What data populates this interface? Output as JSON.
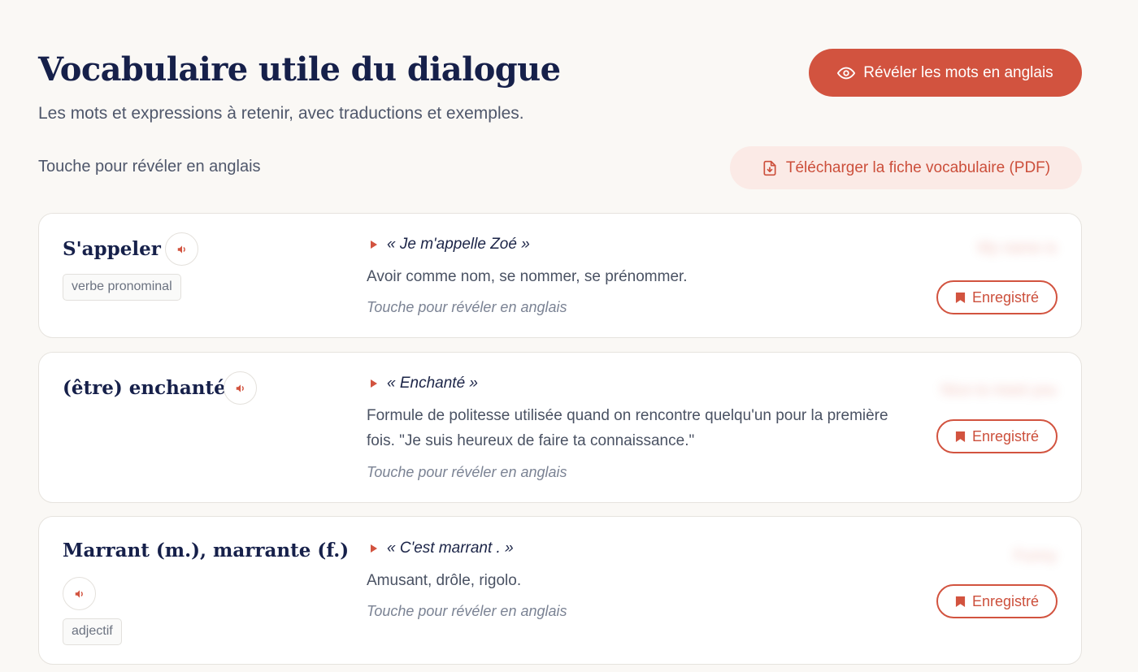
{
  "header": {
    "title": "Vocabulaire utile du dialogue",
    "subtitle": "Les mots et expressions à retenir, avec traductions et exemples.",
    "reveal_all_label": "Révéler les mots en anglais",
    "hint": "Touche pour révéler en anglais",
    "download_label": "Télécharger la fiche vocabulaire (PDF)"
  },
  "colors": {
    "accent": "#d2533f",
    "title": "#16204a",
    "background": "#faf8f5"
  },
  "icons": {
    "reveal": "eye-icon",
    "download": "file-download-icon",
    "audio": "speaker-icon",
    "example": "play-triangle-icon",
    "saved": "bookmark-icon"
  },
  "cards": [
    {
      "term": "S'appeler",
      "tag": "verbe pronominal",
      "example": "« Je m'appelle Zoé »",
      "definition": "Avoir comme nom, se nommer, se prénommer.",
      "hint": "Touche pour révéler en anglais",
      "translation": "My name is",
      "saved_label": "Enregistré"
    },
    {
      "term": "(être) enchanté",
      "tag": "",
      "example": "« Enchanté »",
      "definition": "Formule de politesse utilisée quand on rencontre quelqu'un pour la première fois. \"Je suis heureux de faire ta connaissance.\"",
      "hint": "Touche pour révéler en anglais",
      "translation": "Nice to meet you",
      "saved_label": "Enregistré"
    },
    {
      "term": "Marrant (m.), marrante (f.)",
      "tag": "adjectif",
      "example": "« C'est marrant . »",
      "definition": "Amusant, drôle, rigolo.",
      "hint": "Touche pour révéler en anglais",
      "translation": "Funny",
      "saved_label": "Enregistré"
    }
  ]
}
